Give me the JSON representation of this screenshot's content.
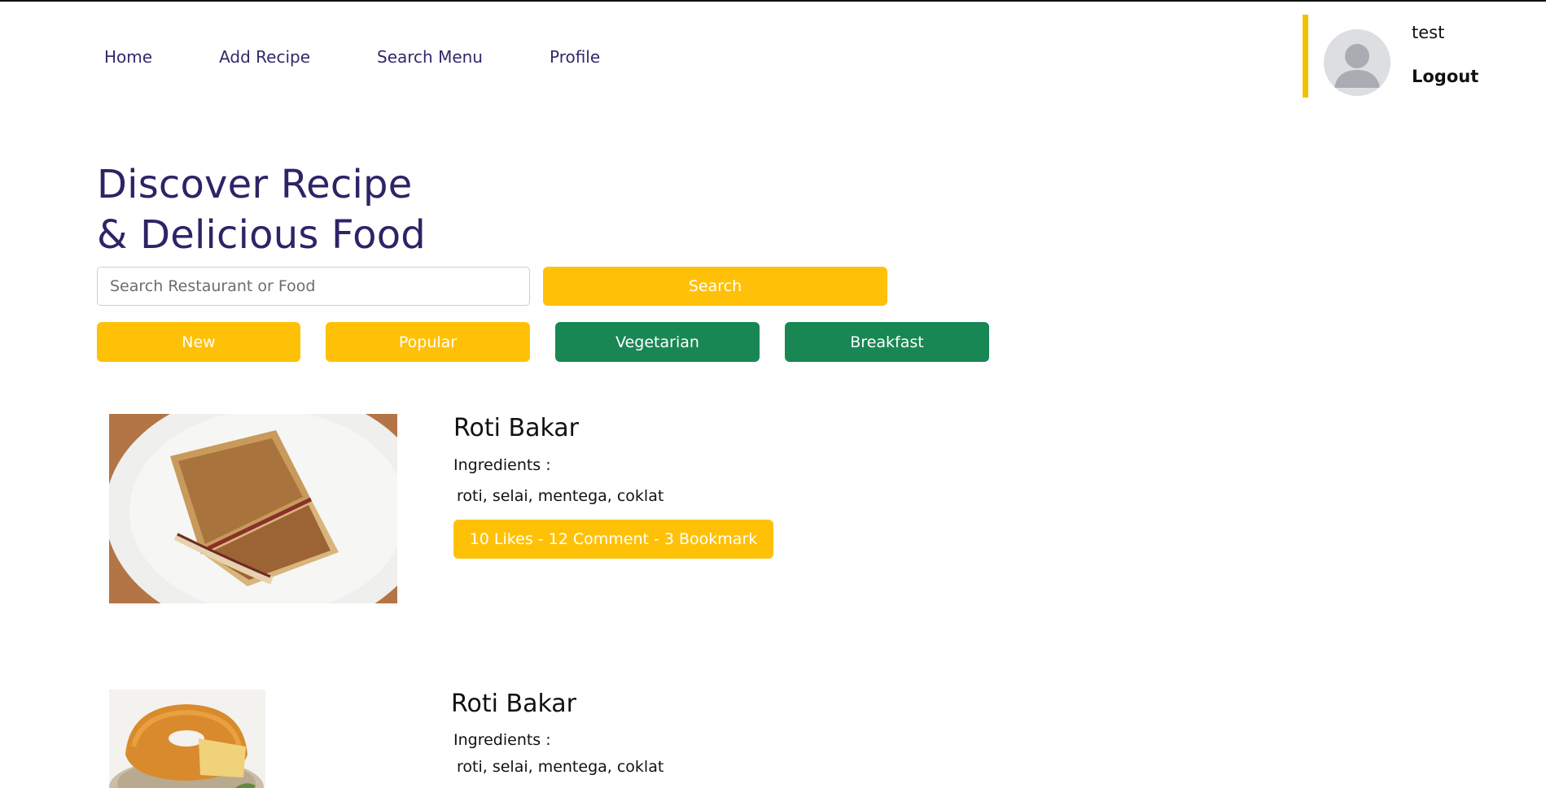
{
  "nav": {
    "items": [
      {
        "label": "Home"
      },
      {
        "label": "Add Recipe"
      },
      {
        "label": "Search Menu"
      },
      {
        "label": "Profile"
      }
    ]
  },
  "user": {
    "name": "test",
    "logout_label": "Logout"
  },
  "hero": {
    "title_line1": "Discover Recipe",
    "title_line2": "& Delicious Food"
  },
  "search": {
    "placeholder": "Search Restaurant or Food",
    "button_label": "Search"
  },
  "categories": [
    {
      "label": "New",
      "color": "#ffc107"
    },
    {
      "label": "Popular",
      "color": "#ffc107"
    },
    {
      "label": "Vegetarian",
      "color": "#198754"
    },
    {
      "label": "Breakfast",
      "color": "#198754"
    }
  ],
  "recipes": [
    {
      "title": "Roti Bakar",
      "ingredients_label": "Ingredients :",
      "ingredients": "roti, selai, mentega, coklat",
      "stats": "10 Likes - 12 Comment - 3 Bookmark",
      "image": "toast-sandwich-photo"
    },
    {
      "title": "Roti Bakar",
      "ingredients_label": "Ingredients :",
      "ingredients": "roti, selai, mentega, coklat",
      "image": "bundt-cake-photo"
    }
  ],
  "colors": {
    "primary_text": "#2d2467",
    "accent_yellow": "#ffc107",
    "accent_green": "#198754",
    "user_border": "#f2c200"
  }
}
